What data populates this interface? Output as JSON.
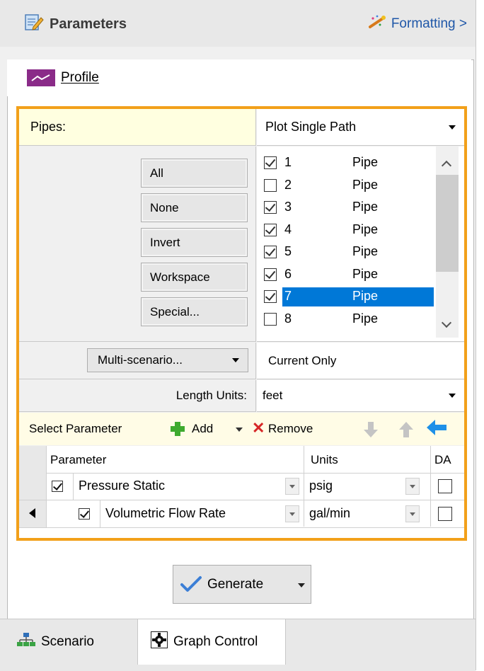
{
  "header": {
    "title": "Parameters",
    "formatting_label": "Formatting >"
  },
  "profile_tab": {
    "label": "Profile"
  },
  "pipes": {
    "label": "Pipes:",
    "mode": "Plot Single Path"
  },
  "selection_buttons": {
    "all": "All",
    "none": "None",
    "invert": "Invert",
    "workspace": "Workspace",
    "special": "Special..."
  },
  "pipe_list": [
    {
      "number": "1",
      "type": "Pipe",
      "checked": true,
      "selected": false
    },
    {
      "number": "2",
      "type": "Pipe",
      "checked": false,
      "selected": false
    },
    {
      "number": "3",
      "type": "Pipe",
      "checked": true,
      "selected": false
    },
    {
      "number": "4",
      "type": "Pipe",
      "checked": true,
      "selected": false
    },
    {
      "number": "5",
      "type": "Pipe",
      "checked": true,
      "selected": false
    },
    {
      "number": "6",
      "type": "Pipe",
      "checked": true,
      "selected": false
    },
    {
      "number": "7",
      "type": "Pipe",
      "checked": true,
      "selected": true
    },
    {
      "number": "8",
      "type": "Pipe",
      "checked": false,
      "selected": false
    }
  ],
  "multi_scenario": {
    "button_label": "Multi-scenario...",
    "value": "Current Only"
  },
  "length_units": {
    "label": "Length Units:",
    "value": "feet"
  },
  "parameter_toolbar": {
    "label": "Select Parameter",
    "add_label": "Add",
    "remove_label": "Remove"
  },
  "parameter_grid": {
    "headers": {
      "parameter": "Parameter",
      "units": "Units",
      "da": "DA"
    },
    "rows": [
      {
        "parameter": "Pressure Static",
        "units": "psig",
        "checked": true,
        "da": false
      },
      {
        "parameter": "Volumetric Flow Rate",
        "units": "gal/min",
        "checked": true,
        "da": false
      }
    ]
  },
  "generate": {
    "label": "Generate"
  },
  "bottom_tabs": {
    "scenario": "Scenario",
    "graph_control": "Graph Control"
  },
  "colors": {
    "frame_highlight": "#f2a01a",
    "selection_blue": "#0078d7",
    "profile_icon": "#8a2b88",
    "add_green": "#3eaa2e",
    "remove_red": "#d62626",
    "arrow_blue": "#1e90e8",
    "formatting_link": "#1f57a8"
  }
}
